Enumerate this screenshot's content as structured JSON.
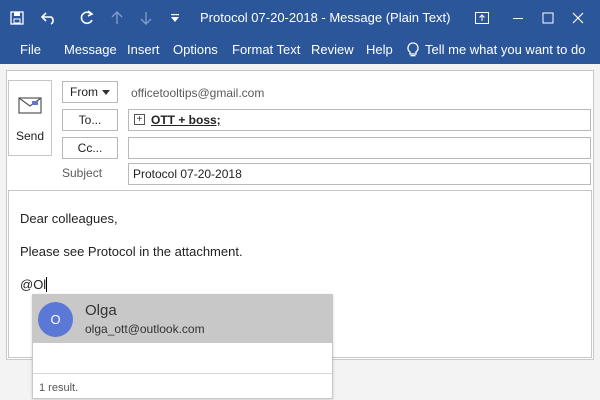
{
  "window": {
    "title": "Protocol 07-20-2018  -  Message (Plain Text)",
    "accent_color": "#2b579a",
    "controls": [
      "ribbon-display-options-icon",
      "minimize-icon",
      "maximize-icon",
      "close-icon"
    ]
  },
  "quick_access": [
    "save-icon",
    "undo-icon",
    "redo-icon",
    "up-arrow-icon",
    "down-arrow-icon",
    "customize-icon"
  ],
  "menu": {
    "items": [
      "File",
      "Message",
      "Insert",
      "Options",
      "Format Text",
      "Review",
      "Help"
    ],
    "tell_me": "Tell me what you want to do"
  },
  "header": {
    "send_label": "Send",
    "from_label": "From",
    "from_email": "officetooltips@gmail.com",
    "to_label": "To...",
    "to_value": "OTT + boss;",
    "cc_label": "Cc...",
    "cc_value": "",
    "subject_label": "Subject",
    "subject_value": "Protocol 07-20-2018"
  },
  "body": {
    "lines": [
      "Dear colleagues,",
      "Please see Protocol in the attachment.",
      "@Ol"
    ]
  },
  "suggestions": {
    "items": [
      {
        "initial": "O",
        "name": "Olga",
        "email": "olga_ott@outlook.com",
        "avatar_color": "#5b78d6"
      }
    ],
    "count_text": "1 result."
  }
}
